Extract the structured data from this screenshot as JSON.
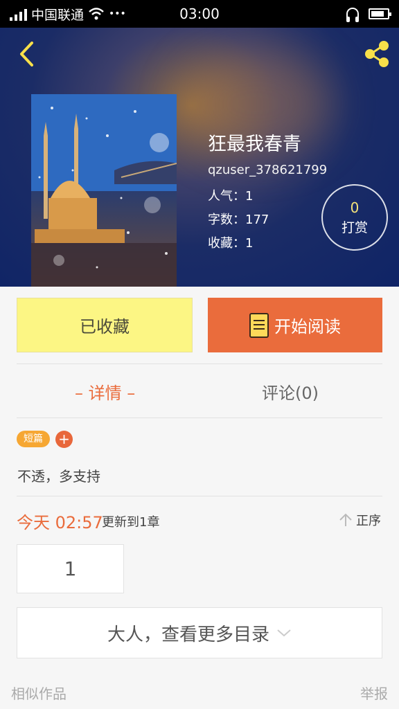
{
  "status_bar": {
    "carrier": "中国联通",
    "dots": "•••",
    "time": "03:00"
  },
  "header": {
    "title": "狂最我春青",
    "author": "qzuser_378621799",
    "popularity": "人气：1",
    "word_count": "字数：177",
    "favorites": "收藏：1",
    "tip_count": "0",
    "tip_label": "打赏"
  },
  "actions": {
    "favorited_label": "已收藏",
    "read_label": "开始阅读"
  },
  "tabs": {
    "detail": "– 详情 –",
    "comments": "评论(0)"
  },
  "tags": {
    "short": "短篇",
    "add": "+"
  },
  "description": "不透，多支持",
  "update": {
    "time": "今天 02:57",
    "chapter": "更新到1章",
    "sort": "正序"
  },
  "chapters": [
    "1"
  ],
  "more_catalog": "大人，查看更多目录",
  "footer": {
    "similar": "相似作品",
    "report": "举报"
  },
  "colors": {
    "accent": "#ea6c3c",
    "favorite_bg": "#fcf684",
    "icon_yellow": "#f8e04a"
  }
}
